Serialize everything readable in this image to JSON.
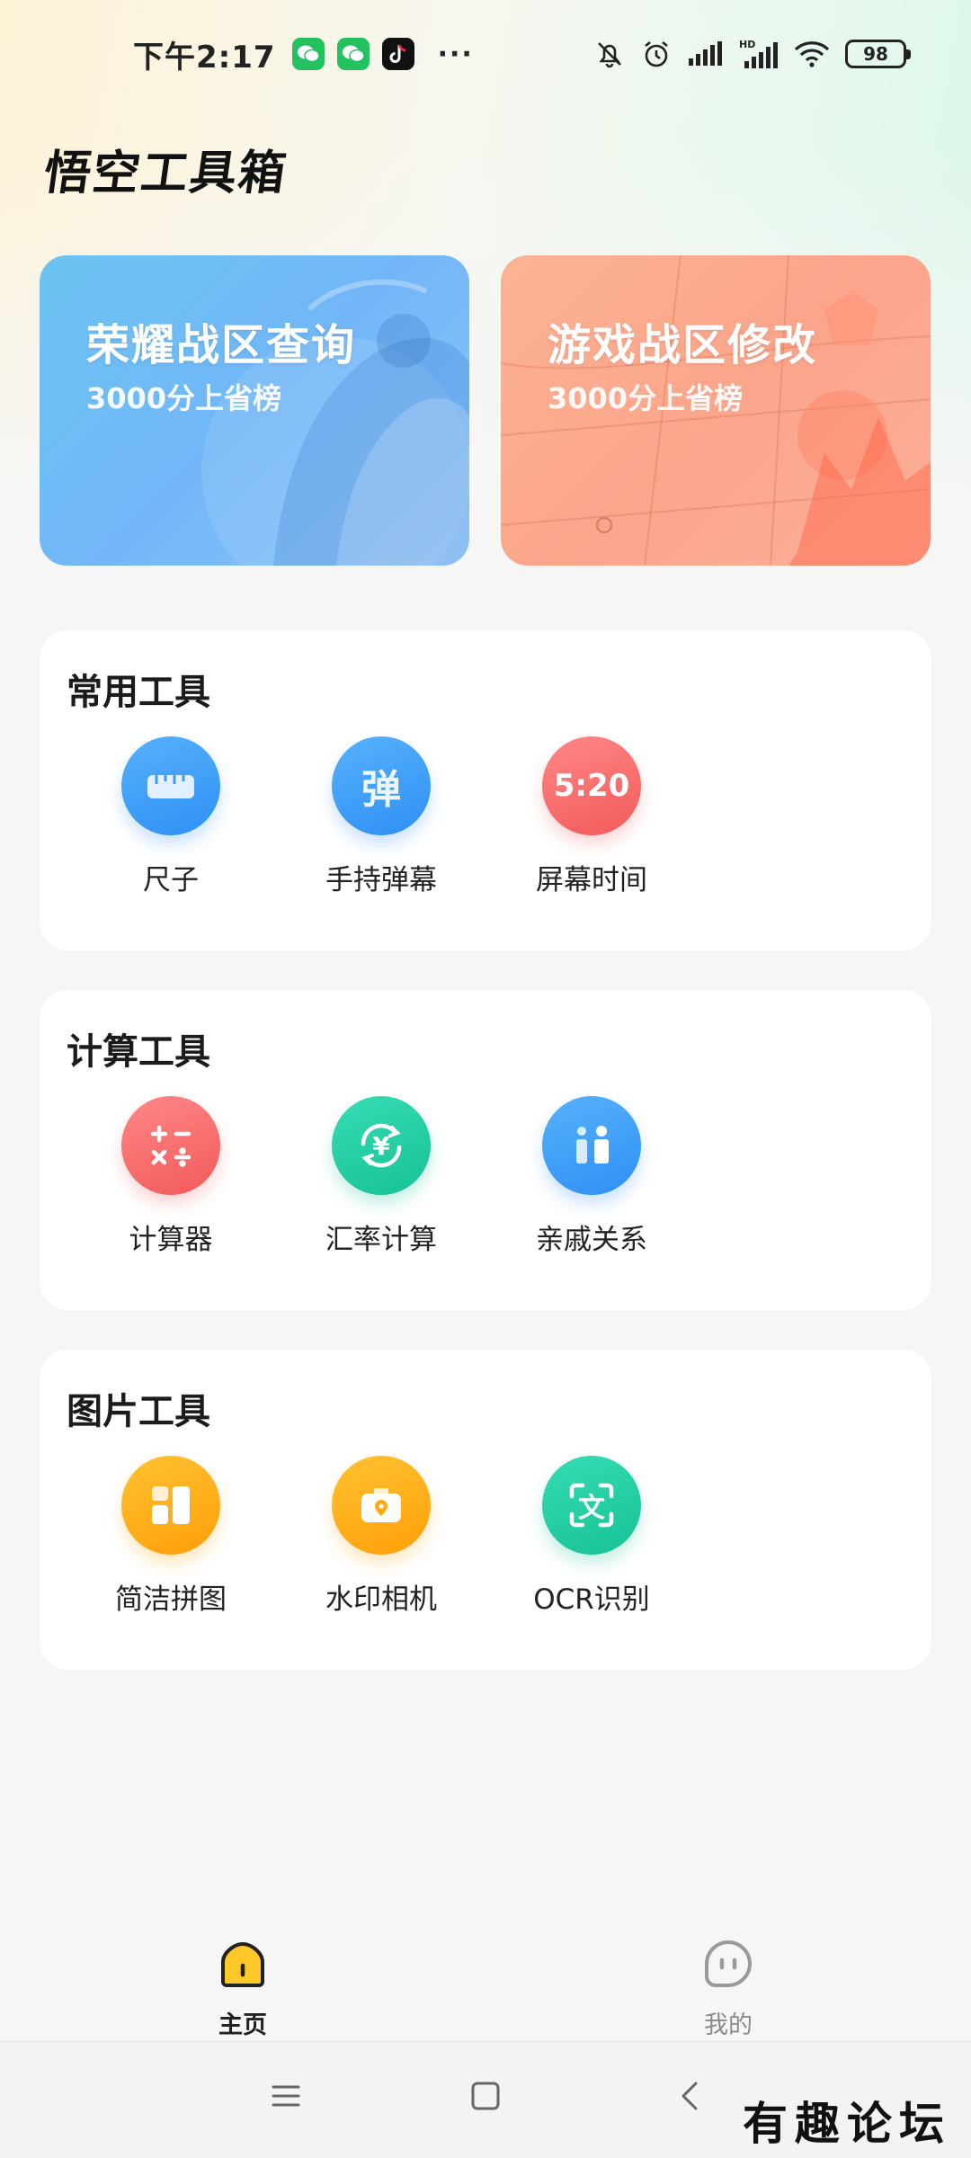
{
  "status_bar": {
    "time": "下午2:17",
    "more": "···",
    "battery": "98",
    "icons": [
      "wechat-icon",
      "wechat-icon",
      "tiktok-icon",
      "mute-bell-icon",
      "alarm-icon",
      "signal-icon",
      "hd-signal-icon",
      "wifi-icon",
      "battery-icon"
    ]
  },
  "app": {
    "title": "悟空工具箱"
  },
  "banners": [
    {
      "title": "荣耀战区查询",
      "subtitle": "3000分上省榜",
      "color": "#6cc4f3"
    },
    {
      "title": "游戏战区修改",
      "subtitle": "3000分上省榜",
      "color": "#fdb393"
    }
  ],
  "sections": [
    {
      "title": "常用工具",
      "tools": [
        {
          "label": "尺子",
          "icon": "ruler-icon",
          "color": "#3d9cf7"
        },
        {
          "label": "手持弹幕",
          "icon": "danmu-icon",
          "glyph": "弹",
          "color": "#3d9cf7"
        },
        {
          "label": "屏幕时间",
          "icon": "screen-time-icon",
          "glyph": "5:20",
          "color": "#f56464"
        }
      ]
    },
    {
      "title": "计算工具",
      "tools": [
        {
          "label": "计算器",
          "icon": "calculator-icon",
          "color": "#f56464"
        },
        {
          "label": "汇率计算",
          "icon": "exchange-rate-icon",
          "glyph": "¥",
          "color": "#1ec69e"
        },
        {
          "label": "亲戚关系",
          "icon": "relatives-icon",
          "color": "#3d9cf7"
        }
      ]
    },
    {
      "title": "图片工具",
      "tools": [
        {
          "label": "简洁拼图",
          "icon": "collage-icon",
          "color": "#ffaa12"
        },
        {
          "label": "水印相机",
          "icon": "watermark-camera-icon",
          "color": "#ffaa12"
        },
        {
          "label": "OCR识别",
          "icon": "ocr-icon",
          "glyph": "文",
          "color": "#1ec69e"
        }
      ]
    }
  ],
  "bottom_nav": [
    {
      "label": "主页",
      "icon": "home-icon",
      "active": true
    },
    {
      "label": "我的",
      "icon": "profile-icon",
      "active": false
    }
  ],
  "system_nav": [
    "menu-icon",
    "home-square-icon",
    "back-icon"
  ],
  "watermark": "有趣论坛"
}
